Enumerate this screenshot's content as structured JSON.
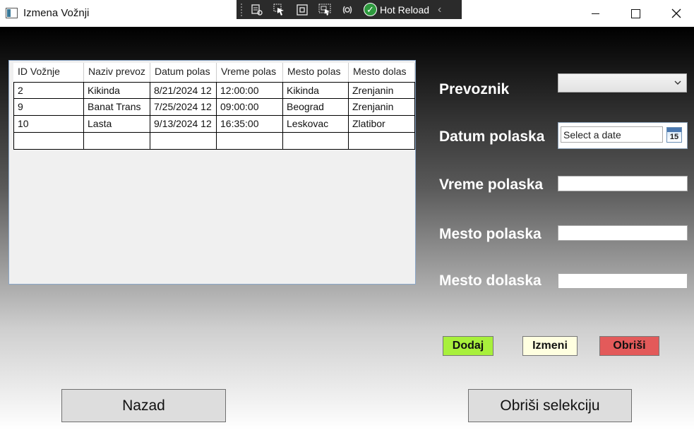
{
  "window": {
    "title": "Izmena Vožnji"
  },
  "debug_toolbar": {
    "hot_reload_label": "Hot Reload",
    "icons": [
      "visual-tree-icon",
      "select-element-icon",
      "display-layout-adorners-icon",
      "track-focus-icon",
      "binding-failures-icon",
      "hot-reload-check-icon"
    ]
  },
  "grid": {
    "columns": [
      "ID Vožnje",
      "Naziv prevoznika",
      "Datum polaska",
      "Vreme polaska",
      "Mesto polaska",
      "Mesto dolaska"
    ],
    "column_display": [
      "ID Vožnje",
      "Naziv prevoz",
      "Datum polas",
      "Vreme polas",
      "Mesto polas",
      "Mesto dolas"
    ],
    "rows": [
      [
        "2",
        "Kikinda",
        "8/21/2024 12",
        "12:00:00",
        "Kikinda",
        "Zrenjanin"
      ],
      [
        "9",
        "Banat Trans",
        "7/25/2024 12",
        "09:00:00",
        "Beograd",
        "Zrenjanin"
      ],
      [
        "10",
        "Lasta",
        "9/13/2024 12",
        "16:35:00",
        "Leskovac",
        "Zlatibor"
      ],
      [
        "",
        "",
        "",
        "",
        "",
        ""
      ]
    ]
  },
  "form": {
    "prevoznik_label": "Prevoznik",
    "prevoznik_value": "",
    "datum_label": "Datum polaska",
    "datum_placeholder": "Select a date",
    "calendar_day": "15",
    "vreme_label": "Vreme polaska",
    "vreme_value": "",
    "mesto_polaska_label": "Mesto polaska",
    "mesto_polaska_value": "",
    "mesto_dolaska_label": "Mesto dolaska",
    "mesto_dolaska_value": ""
  },
  "actions": {
    "dodaj": "Dodaj",
    "izmeni": "Izmeni",
    "obrisi": "Obriši"
  },
  "bottom": {
    "nazad": "Nazad",
    "obrisi_selekciju": "Obriši selekciju"
  },
  "colors": {
    "dodaj_bg": "#a8f03c",
    "izmeni_bg": "#ffffe0",
    "obrisi_bg": "#e35a5a",
    "hot_reload_green": "#2e9a3e"
  }
}
